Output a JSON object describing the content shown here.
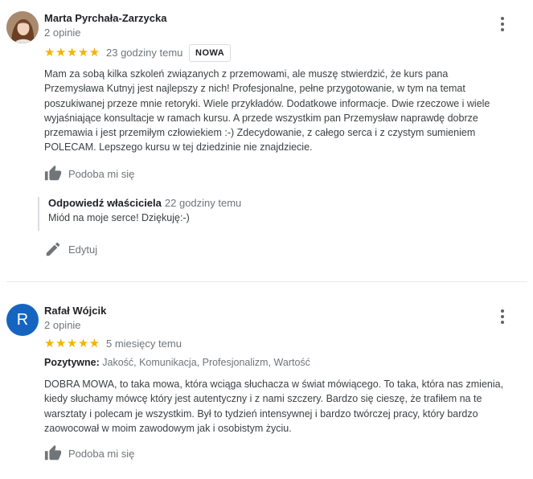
{
  "reviews": [
    {
      "author": "Marta Pyrchała-Zarzycka",
      "reviews_count": "2 opinie",
      "rating": 5,
      "stars": "★★★★★",
      "time": "23 godziny temu",
      "badge": "NOWA",
      "text": "Mam za sobą kilka szkoleń związanych z przemowami, ale muszę stwierdzić, że kurs pana Przemysława Kutnyj jest najlepszy z nich! Profesjonalne, pełne przygotowanie, w tym na temat poszukiwanej przeze mnie retoryki. Wiele przykładów. Dodatkowe informacje. Dwie rzeczowe i wiele wyjaśniające konsultacje w ramach kursu. A przede wszystkim pan Przemysław naprawdę dobrze przemawia i jest przemiłym człowiekiem :-) Zdecydowanie, z całego serca i z czystym sumieniem POLECAM. Lepszego kursu w tej dziedzinie nie znajdziecie.",
      "like_label": "Podoba mi się",
      "reply": {
        "label": "Odpowiedź właściciela",
        "time": "22 godziny temu",
        "text": "Miód na moje serce! Dziękuję:-)"
      },
      "edit_label": "Edytuj"
    },
    {
      "author": "Rafał Wójcik",
      "avatar_letter": "R",
      "avatar_color": "#1565c0",
      "reviews_count": "2 opinie",
      "rating": 5,
      "stars": "★★★★★",
      "time": "5 miesięcy temu",
      "positives_label": "Pozytywne:",
      "positives": "Jakość, Komunikacja, Profesjonalizm, Wartość",
      "text": "DOBRA MOWA, to taka mowa, która wciąga słuchacza w świat mówiącego. To taka, która nas zmienia, kiedy słuchamy mówcę który jest autentyczny i z nami szczery. Bardzo się cieszę, że trafiłem na te warsztaty i polecam je wszystkim. Był to tydzień intensywnej i bardzo twórczej pracy, który bardzo zaowocował w moim zawodowym jak i osobistym życiu.",
      "like_label": "Podoba mi się"
    }
  ],
  "icons": {
    "menu": "more-vert-icon",
    "like": "thumb-up-icon",
    "edit": "pencil-icon"
  },
  "colors": {
    "star": "#f4b400",
    "muted": "#70757a",
    "avatar_blue": "#1565c0"
  }
}
